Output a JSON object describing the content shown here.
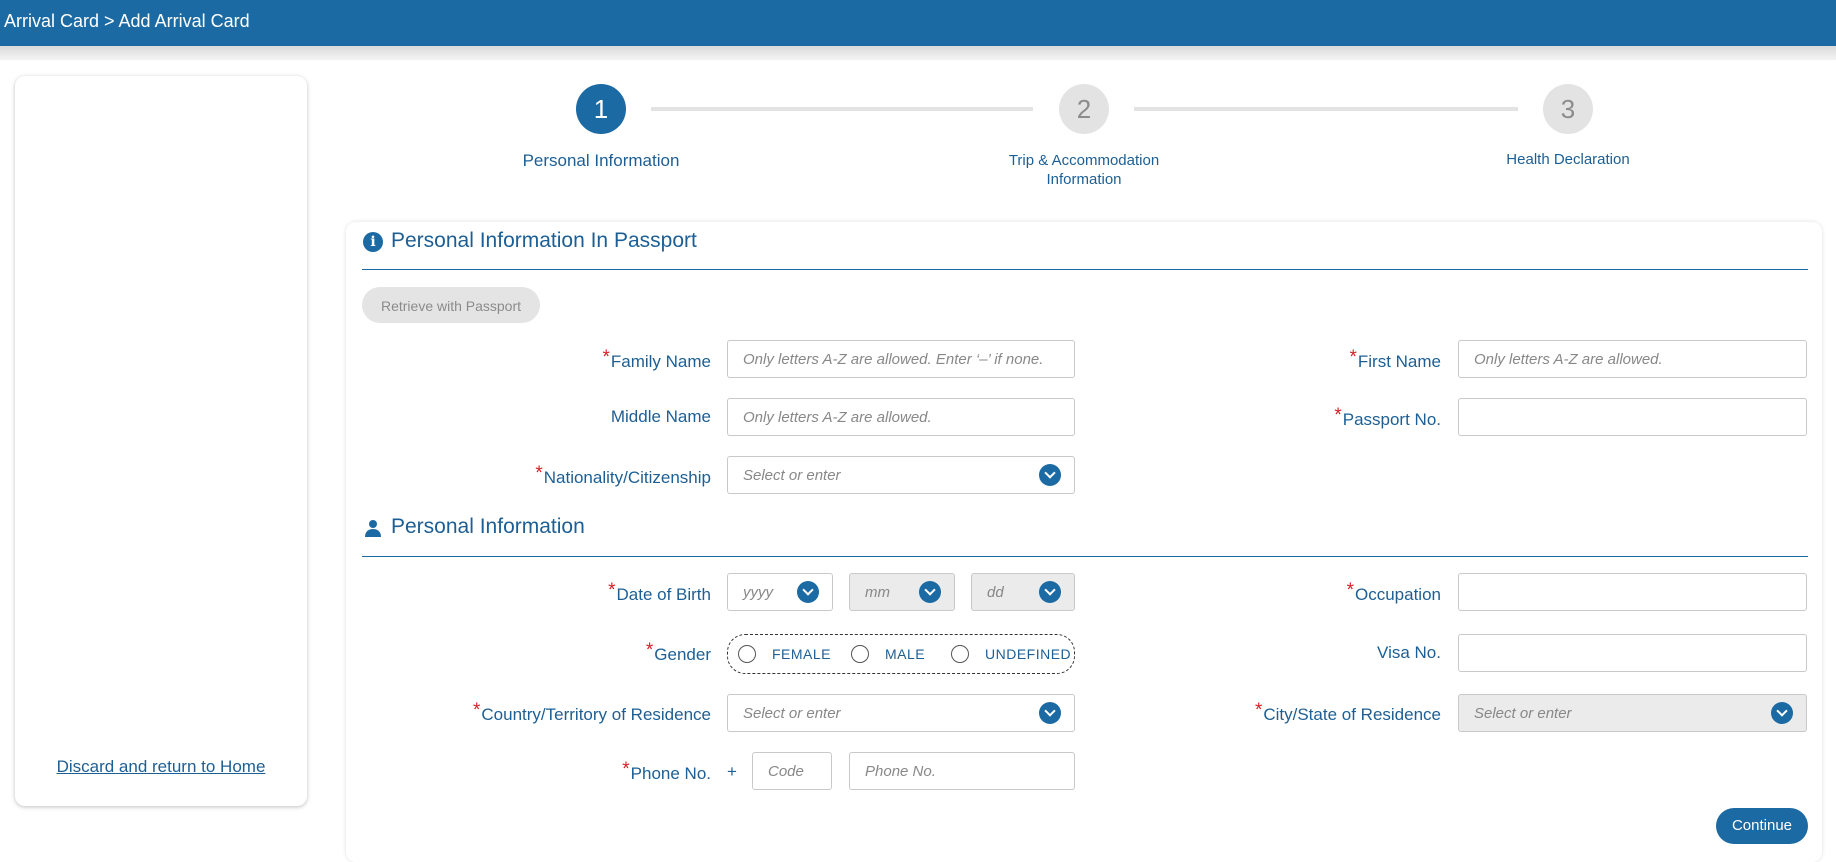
{
  "header": {
    "breadcrumb": "Arrival Card > Add Arrival Card"
  },
  "sidebar": {
    "discard_link": "Discard and return to Home"
  },
  "stepper": {
    "steps": [
      {
        "number": "1",
        "label": "Personal Information"
      },
      {
        "number": "2",
        "label_line1": "Trip & Accommodation",
        "label_line2": "Information"
      },
      {
        "number": "3",
        "label": "Health Declaration"
      }
    ]
  },
  "passport_section": {
    "title": "Personal Information In Passport",
    "icon": "info-icon",
    "retrieve_button": "Retrieve with Passport",
    "fields": {
      "family_name": {
        "label": "Family Name",
        "placeholder": "Only letters A-Z are allowed. Enter ‘–’ if none."
      },
      "first_name": {
        "label": "First Name",
        "placeholder": "Only letters A-Z are allowed."
      },
      "middle_name": {
        "label": "Middle Name",
        "placeholder": "Only letters A-Z are allowed."
      },
      "passport_no": {
        "label": "Passport No.",
        "placeholder": ""
      },
      "nationality": {
        "label": "Nationality/Citizenship",
        "placeholder": "Select or enter"
      }
    }
  },
  "personal_section": {
    "title": "Personal Information",
    "icon": "person-icon",
    "fields": {
      "dob": {
        "label": "Date of Birth",
        "year": "yyyy",
        "month": "mm",
        "day": "dd"
      },
      "occupation": {
        "label": "Occupation",
        "placeholder": ""
      },
      "gender": {
        "label": "Gender",
        "options": [
          "FEMALE",
          "MALE",
          "UNDEFINED"
        ]
      },
      "visa_no": {
        "label": "Visa No.",
        "placeholder": ""
      },
      "country": {
        "label": "Country/Territory of Residence",
        "placeholder": "Select or enter"
      },
      "city": {
        "label": "City/State of Residence",
        "placeholder": "Select or enter"
      },
      "phone": {
        "label": "Phone No.",
        "plus": "+",
        "code_placeholder": "Code",
        "number_placeholder": "Phone No."
      }
    }
  },
  "footer": {
    "continue_button": "Continue"
  },
  "colors": {
    "primary": "#1c6aa3",
    "required": "#d61f26",
    "muted": "#e3e3e3"
  }
}
